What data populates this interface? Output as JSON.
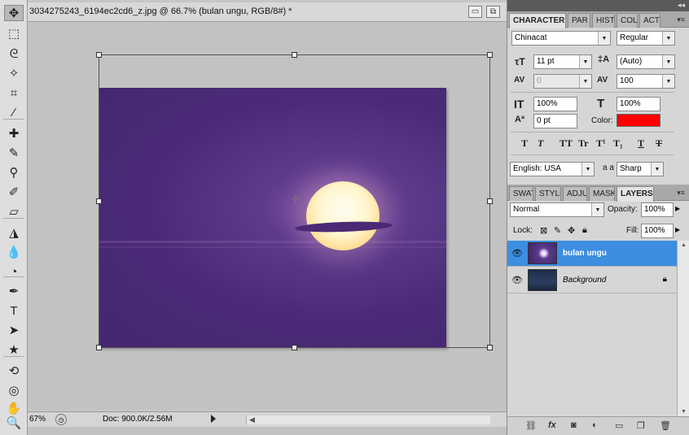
{
  "document": {
    "title": "3034275243_6194ec2cd6_z.jpg @ 66.7% (bulan ungu, RGB/8#) *",
    "minimize_glyph": "▭",
    "restore_glyph": "⧉"
  },
  "status_bar": {
    "zoom": "67%",
    "doc_info": "Doc: 900.0K/2.56M"
  },
  "tools": [
    {
      "name": "move-tool-icon",
      "glyph": "✥"
    },
    {
      "name": "marquee-tool-icon",
      "glyph": "⬚"
    },
    {
      "name": "lasso-tool-icon",
      "glyph": "ᘓ"
    },
    {
      "name": "magic-wand-tool-icon",
      "glyph": "✧"
    },
    {
      "name": "crop-tool-icon",
      "glyph": "⌗"
    },
    {
      "name": "eyedropper-tool-icon",
      "glyph": "⁄"
    },
    {
      "name": "healing-brush-tool-icon",
      "glyph": "✚"
    },
    {
      "name": "brush-tool-icon",
      "glyph": "✎"
    },
    {
      "name": "clone-stamp-tool-icon",
      "glyph": "⚲"
    },
    {
      "name": "history-brush-tool-icon",
      "glyph": "✐"
    },
    {
      "name": "eraser-tool-icon",
      "glyph": "▱"
    },
    {
      "name": "paint-bucket-tool-icon",
      "glyph": "◮"
    },
    {
      "name": "blur-tool-icon",
      "glyph": "💧"
    },
    {
      "name": "dodge-tool-icon",
      "glyph": "◔"
    },
    {
      "name": "pen-tool-icon",
      "glyph": "✒"
    },
    {
      "name": "type-tool-icon",
      "glyph": "T"
    },
    {
      "name": "path-selection-tool-icon",
      "glyph": "➤"
    },
    {
      "name": "shape-tool-icon",
      "glyph": "★"
    },
    {
      "name": "3d-rotate-tool-icon",
      "glyph": "⟲"
    },
    {
      "name": "3d-orbit-tool-icon",
      "glyph": "◎"
    },
    {
      "name": "hand-tool-icon",
      "glyph": "✋"
    },
    {
      "name": "zoom-tool-icon",
      "glyph": "🔍"
    }
  ],
  "character_panel": {
    "tabs": [
      "CHARACTER",
      "PAR",
      "HIST",
      "COL",
      "ACT"
    ],
    "font_family": "Chinacat",
    "font_style": "Regular",
    "font_size": "11 pt",
    "leading": "(Auto)",
    "kerning": "0",
    "tracking": "100",
    "vertical_scale": "100%",
    "horizontal_scale": "100%",
    "baseline_shift": "0 pt",
    "color_label": "Color:",
    "text_color": "#ff0000",
    "type_buttons": [
      "T",
      "T",
      "TT",
      "Tr",
      "T¹",
      "T₁",
      "T",
      "T"
    ],
    "language": "English: USA",
    "aa_label": "a a",
    "antialias": "Sharp"
  },
  "layers_panel": {
    "tabs": [
      "SWAT",
      "STYLE",
      "ADJU",
      "MASK",
      "LAYERS"
    ],
    "blend_mode": "Normal",
    "opacity_label": "Opacity:",
    "opacity": "100%",
    "lock_label": "Lock:",
    "fill_label": "Fill:",
    "fill": "100%",
    "layers": [
      {
        "name": "bulan ungu",
        "selected": true
      },
      {
        "name": "Background",
        "selected": false
      }
    ]
  },
  "colors": {
    "selection_blue": "#3d8ee0",
    "photo_purple": "#4b2b78"
  }
}
